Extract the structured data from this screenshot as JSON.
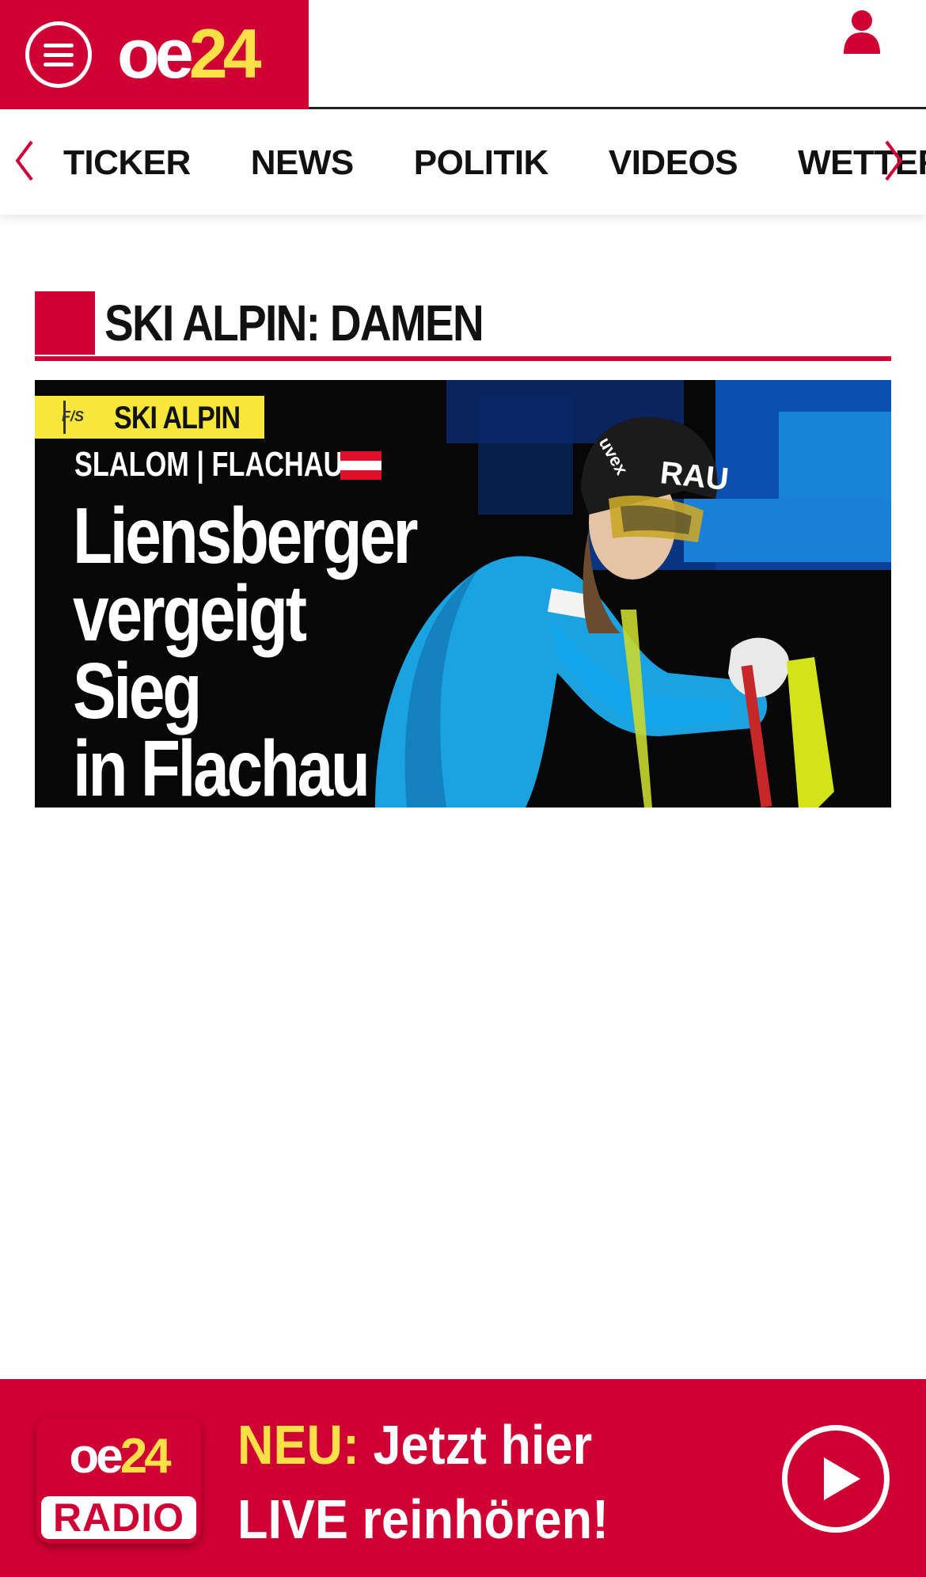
{
  "header": {
    "logo_oe": "oe",
    "logo_num": "24",
    "menu_icon": "hamburger-menu-icon",
    "user_icon": "user-icon",
    "brand_color": "#cf0033",
    "accent_color": "#fde048"
  },
  "nav": {
    "items": [
      {
        "label": "TICKER"
      },
      {
        "label": "NEWS"
      },
      {
        "label": "POLITIK"
      },
      {
        "label": "VIDEOS"
      },
      {
        "label": "WETTER"
      }
    ],
    "prev_icon": "chevron-left-icon",
    "next_icon": "chevron-right-icon"
  },
  "section": {
    "title": "SKI ALPIN: DAMEN"
  },
  "teaser": {
    "label_fis": "F/S",
    "label": "SKI ALPIN",
    "subline": "SLALOM | FLACHAU",
    "headline_1": "Liensberger",
    "headline_2": "vergeigt Sieg",
    "headline_3": "in Flachau",
    "helmet_text": "RAU",
    "helmet_brand": "uvex"
  },
  "radio": {
    "logo_oe": "oe",
    "logo_num": "24",
    "logo_label": "RADIO",
    "neu": "NEU:",
    "line1": "Jetzt hier",
    "line2": "LIVE reinhören!",
    "play_icon": "play-icon"
  }
}
